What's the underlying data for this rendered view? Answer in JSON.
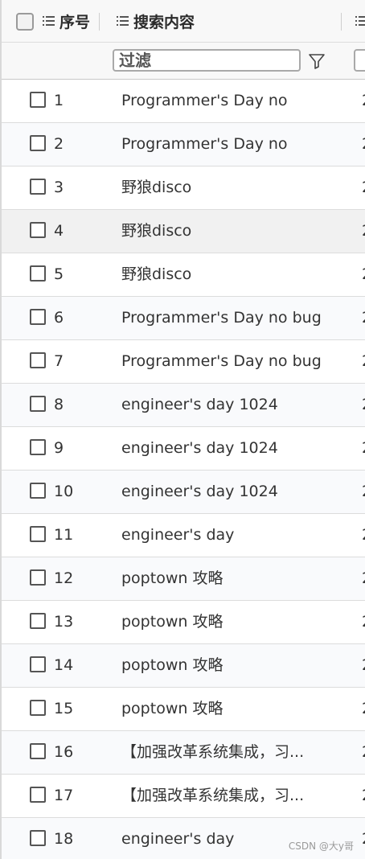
{
  "header": {
    "select_all_checked": false,
    "columns": [
      {
        "label": "序号",
        "icon": "menu-icon"
      },
      {
        "label": "搜索内容",
        "icon": "menu-icon"
      },
      {
        "label": "",
        "icon": "menu-icon"
      }
    ]
  },
  "filter": {
    "placeholder": "过滤",
    "value": "",
    "filter_icon": "funnel-icon"
  },
  "rows": [
    {
      "seq": "1",
      "content": "Programmer's Day no",
      "extra": "2"
    },
    {
      "seq": "2",
      "content": "Programmer's Day no",
      "extra": "2"
    },
    {
      "seq": "3",
      "content": "野狼disco",
      "extra": "2"
    },
    {
      "seq": "4",
      "content": "野狼disco",
      "extra": "2"
    },
    {
      "seq": "5",
      "content": "野狼disco",
      "extra": "2"
    },
    {
      "seq": "6",
      "content": "Programmer's Day no bug",
      "extra": "2"
    },
    {
      "seq": "7",
      "content": "Programmer's Day no bug",
      "extra": "2"
    },
    {
      "seq": "8",
      "content": "engineer's day 1024",
      "extra": "2"
    },
    {
      "seq": "9",
      "content": "engineer's day 1024",
      "extra": "2"
    },
    {
      "seq": "10",
      "content": "engineer's day 1024",
      "extra": "2"
    },
    {
      "seq": "11",
      "content": "engineer's day",
      "extra": "2"
    },
    {
      "seq": "12",
      "content": "poptown 攻略",
      "extra": "2"
    },
    {
      "seq": "13",
      "content": "poptown 攻略",
      "extra": "2"
    },
    {
      "seq": "14",
      "content": "poptown 攻略",
      "extra": "2"
    },
    {
      "seq": "15",
      "content": "poptown 攻略",
      "extra": "2"
    },
    {
      "seq": "16",
      "content": "【加强改革系统集成，习...",
      "extra": "2"
    },
    {
      "seq": "17",
      "content": "【加强改革系统集成，习...",
      "extra": "2"
    },
    {
      "seq": "18",
      "content": "engineer's day",
      "extra": "2"
    }
  ],
  "hovered_row": 4,
  "watermark": "CSDN @大y哥"
}
